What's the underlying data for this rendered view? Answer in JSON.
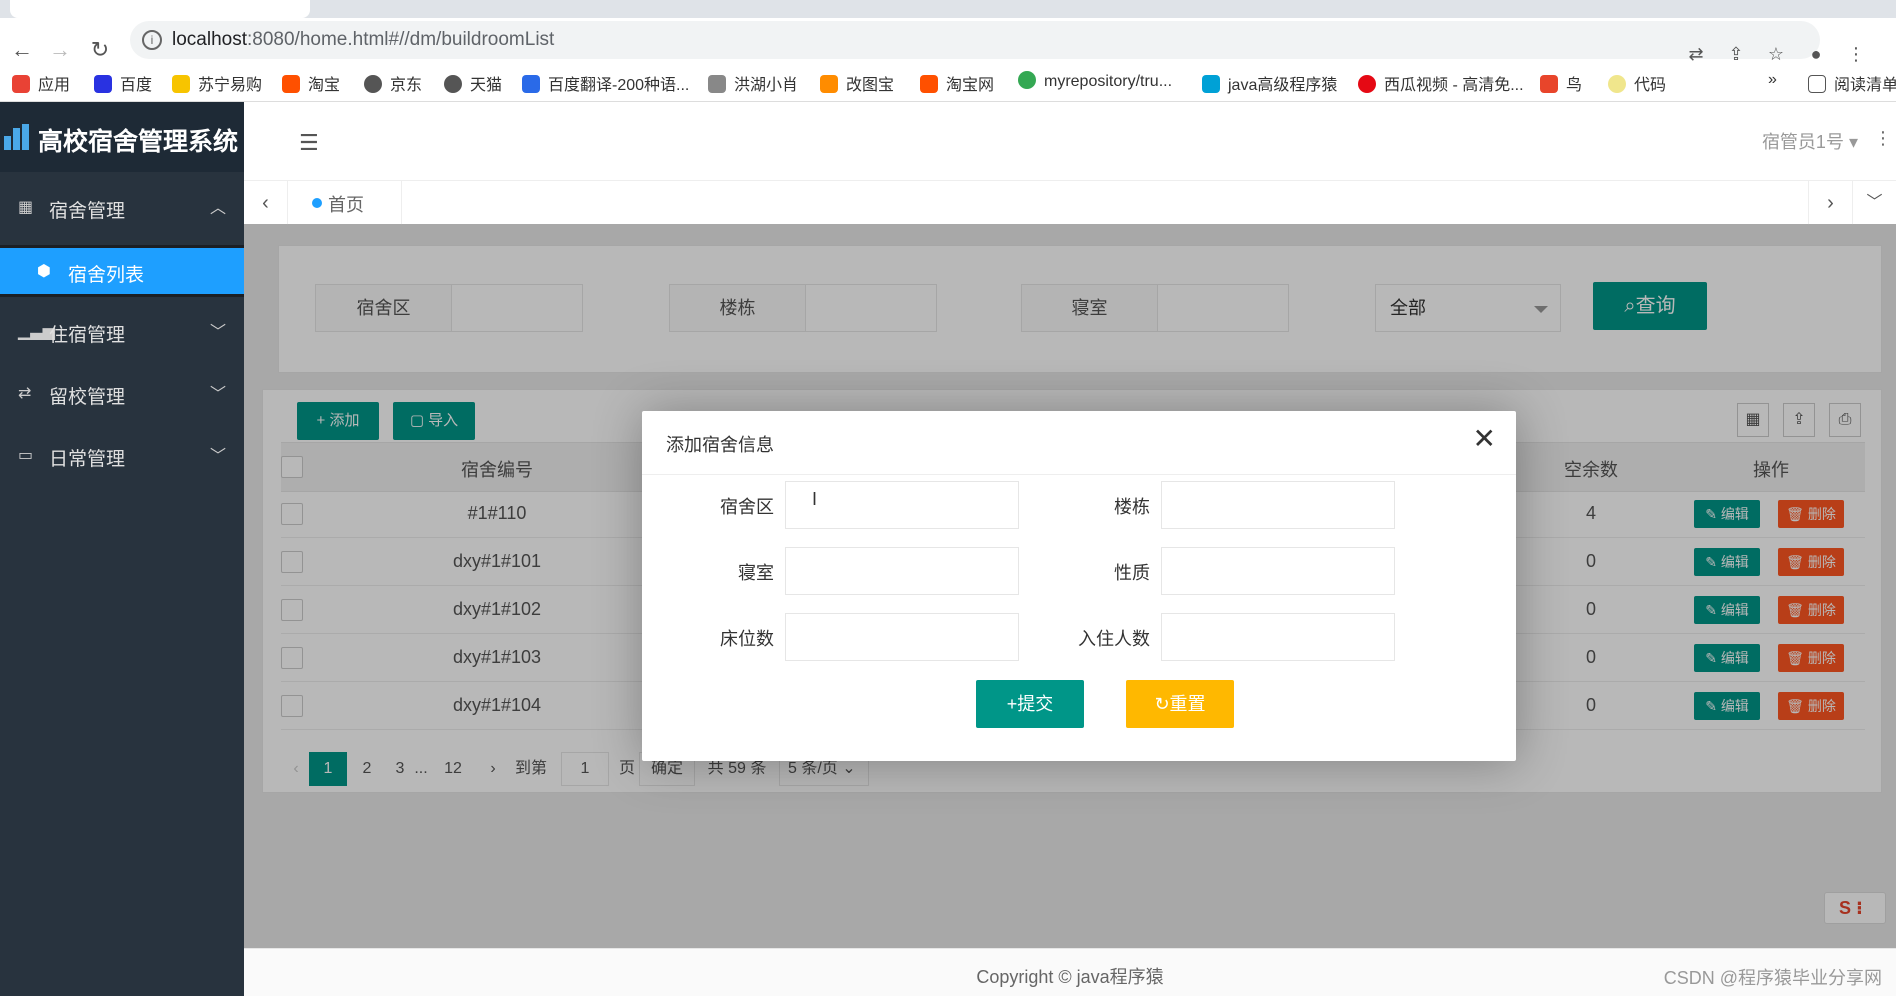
{
  "browser": {
    "url_host": "localhost",
    "url_path": ":8080/home.html#//dm/buildroomList",
    "bookmarks": [
      "应用",
      "百度",
      "苏宁易购",
      "淘宝",
      "京东",
      "天猫",
      "百度翻译-200种语...",
      "洪湖小肖",
      "改图宝",
      "淘宝网",
      "myrepository/tru...",
      "java高级程序猿",
      "西瓜视频 - 高清免...",
      "鸟",
      "代码"
    ],
    "more": "»",
    "reading_list": "阅读清单"
  },
  "sidebar": {
    "app_title": "高校宿舍管理系统",
    "menu": [
      {
        "label": "宿舍管理",
        "arrow": "^"
      },
      {
        "label": "住宿管理",
        "arrow": "v"
      },
      {
        "label": "留校管理",
        "arrow": "v"
      },
      {
        "label": "日常管理",
        "arrow": "v"
      }
    ],
    "active_sub": "宿舍列表"
  },
  "header": {
    "user": "宿管员1号"
  },
  "tabs": {
    "home": "首页"
  },
  "search": {
    "area_label": "宿舍区",
    "building_label": "楼栋",
    "room_label": "寝室",
    "select_value": "全部",
    "query_button": "查询"
  },
  "toolbar": {
    "add_button": "添加",
    "import_button": "导入"
  },
  "table": {
    "col_code": "宿舍编号",
    "col_free": "空余数",
    "col_action": "操作",
    "edit_label": "编辑",
    "delete_label": "删除",
    "rows": [
      {
        "code": "#1#110",
        "free": "4"
      },
      {
        "code": "dxy#1#101",
        "free": "0"
      },
      {
        "code": "dxy#1#102",
        "free": "0"
      },
      {
        "code": "dxy#1#103",
        "free": "0"
      },
      {
        "code": "dxy#1#104",
        "free": "0"
      }
    ]
  },
  "pagination": {
    "pages": [
      "1",
      "2",
      "3",
      "...",
      "12"
    ],
    "goto_label": "到第",
    "goto_value": "1",
    "page_suffix": "页",
    "confirm": "确定",
    "total": "共 59 条",
    "page_size": "5 条/页"
  },
  "dialog": {
    "title": "添加宿舍信息",
    "fields": {
      "area": "宿舍区",
      "building": "楼栋",
      "room": "寝室",
      "nature": "性质",
      "beds": "床位数",
      "occupants": "入住人数"
    },
    "submit": "提交",
    "reset": "重置"
  },
  "footer": {
    "copyright": "Copyright © java程序猿",
    "watermark": "CSDN @程序猿毕业分享网"
  },
  "colors": {
    "primary": "#009688",
    "danger": "#ff5722",
    "warning": "#ffb800",
    "sidebar": "#28333e",
    "active": "#1e9fff"
  }
}
